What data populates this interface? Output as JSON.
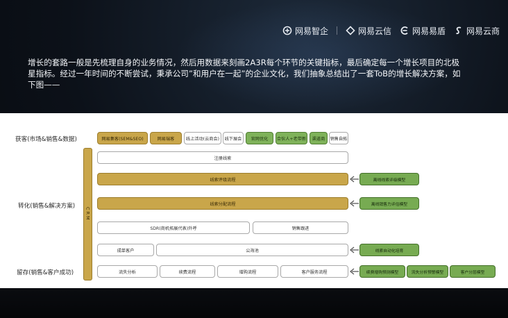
{
  "header": {
    "logos": [
      {
        "icon": "netease-zhiqi-icon",
        "label": "网易智企"
      },
      {
        "icon": "netease-yunxin-icon",
        "label": "网易云信"
      },
      {
        "icon": "netease-yiqi-icon",
        "label": "网易易盾"
      },
      {
        "icon": "netease-yunshang-icon",
        "label": "网易云商"
      }
    ]
  },
  "intro": {
    "text": "增长的套路一般是先梳理自身的业务情况，然后用数据来刻画2A3R每个环节的关键指标，最后确定每一个增长项目的北极星指标。经过一年时间的不断尝试，秉承公司”和用户在一起”的企业文化，我们抽象总结出了一套ToB的增长解决方案，如下图——"
  },
  "diagram": {
    "row_labels": {
      "acquire": "获客(市场&销售&数据)",
      "convert": "转化(销售&解决方案)",
      "retain": "留存(销售&客户成功)"
    },
    "crm_label": "CRM",
    "acquire_boxes": [
      "网易集客(SEM&SEO)",
      "网易瑞客",
      "线上活动(云商会)",
      "线下展会",
      "官网优化",
      "合伙人+老带新",
      "渠道商",
      "销售自拓"
    ],
    "register": "注册线索",
    "lead_eval": "线索评级流程",
    "lead_eval_model": "离线线索评级模型",
    "lead_assign": "线索分配流程",
    "sales_model": "离线销售力评估模型",
    "sdr": "SDR(商机拓展代表)外呼",
    "sales_follow": "销售跟进",
    "closed": "成单客户",
    "pool": "公海池",
    "auto_recycle": "线索自动化培育",
    "retain_boxes": [
      "流失分析",
      "续费流程",
      "增购流程",
      "客户服务流程"
    ],
    "retain_models": [
      "续费增购预测模型",
      "流失分析预警模型",
      "客户分层模型"
    ],
    "colors": {
      "gold": "#c9a64a",
      "green": "#7fb25a"
    }
  }
}
